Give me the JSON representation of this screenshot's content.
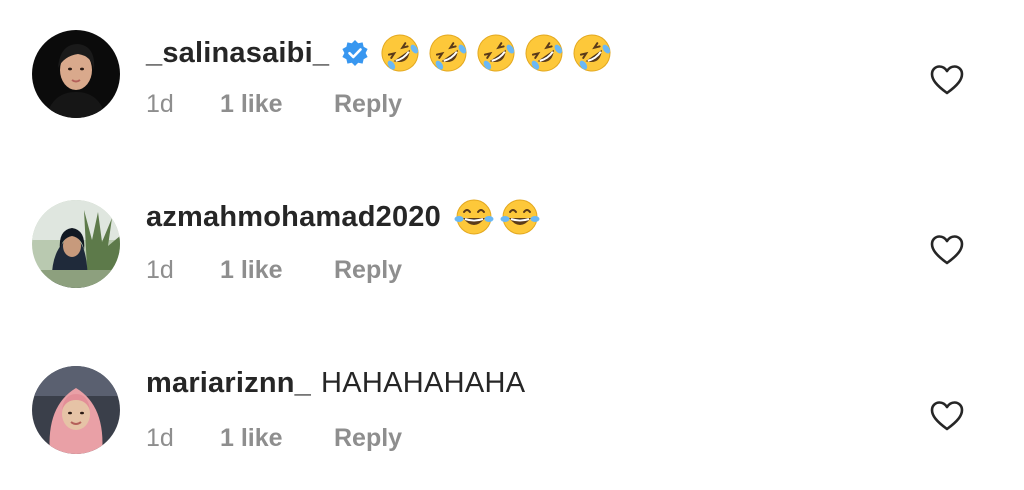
{
  "comments": [
    {
      "username": "_salinasaibi_",
      "verified": true,
      "text": "",
      "emojis": [
        "rolling-on-floor-laughing",
        "rolling-on-floor-laughing",
        "rolling-on-floor-laughing",
        "rolling-on-floor-laughing",
        "rolling-on-floor-laughing"
      ],
      "time": "1d",
      "likes": "1 like",
      "reply": "Reply"
    },
    {
      "username": "azmahmohamad2020",
      "verified": false,
      "text": "",
      "emojis": [
        "face-with-tears-of-joy",
        "face-with-tears-of-joy"
      ],
      "time": "1d",
      "likes": "1 like",
      "reply": "Reply"
    },
    {
      "username": "mariariznn_",
      "verified": false,
      "text": "HAHAHAHAHA",
      "emojis": [],
      "time": "1d",
      "likes": "1 like",
      "reply": "Reply"
    }
  ],
  "icons": {
    "verified": "verified-badge-icon",
    "like": "heart-outline-icon"
  },
  "colors": {
    "text": "#262626",
    "secondary": "#8e8e8e",
    "verified": "#3897f0",
    "emoji": "#fdc83a"
  }
}
